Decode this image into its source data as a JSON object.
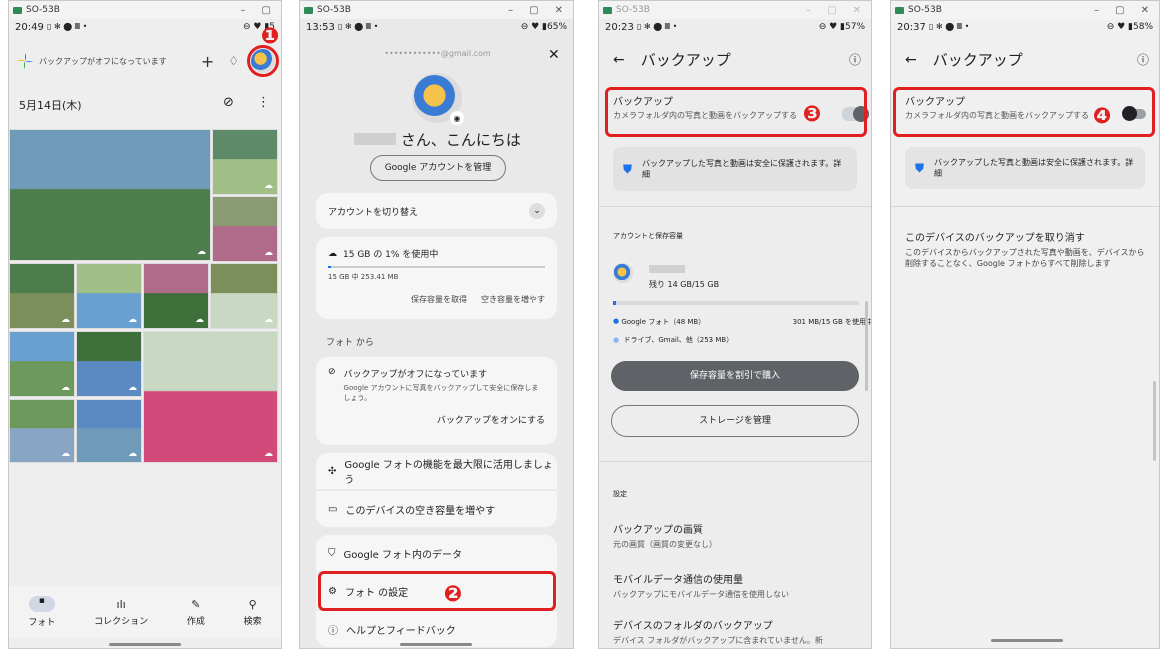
{
  "device": "SO-53B",
  "panel1": {
    "time": "20:49",
    "status_icons": "▯ ✻ ⬤ 𝄜 •",
    "battery": "⊖ ♥ ▮5",
    "banner": "バックアップがオフになっています",
    "date": "5月14日(木)",
    "nav": [
      "フォト",
      "コレクション",
      "作成",
      "検索"
    ],
    "callout": "❶",
    "photo_colors": [
      "#6f9bb9",
      "#5e8a6a",
      "#8a9a73",
      "#4e7d4d",
      "#9fbf86",
      "#b06a8a",
      "#7c8f5a",
      "#6aa0d0",
      "#3f6f3a",
      "#c9d8c2",
      "#6d9a5c",
      "#5b8ac2",
      "#d24a7a",
      "#89a5c4"
    ]
  },
  "panel2": {
    "time": "13:53",
    "status_icons": "▯ ✻ ⬤ 𝄜 •",
    "battery": "⊖ ♥ ▮65%",
    "email": "••••••••••••@gmail.com",
    "greeting": "さん、こんにちは",
    "manage_account": "Google アカウントを管理",
    "switch_account": "アカウントを切り替え",
    "storage_title": "15 GB の 1% を使用中",
    "storage_detail": "15 GB 中 253.41 MB",
    "get_storage": "保存容量を取得",
    "free_up": "空き容量を増やす",
    "from_photos": "フォト から",
    "backup_off_title": "バックアップがオフになっています",
    "backup_off_desc": "Google アカウントに写真をバックアップして安全に保存しましょう。",
    "turn_on_backup": "バックアップをオンにする",
    "make_most": "Google フォトの機能を最大限に活用しましょう",
    "free_device": "このデバイスの空き容量を増やす",
    "your_data": "Google フォト内のデータ",
    "settings": "フォト の設定",
    "help": "ヘルプとフィードバック",
    "callout": "❷"
  },
  "panel3": {
    "time": "20:23",
    "status_icons": "▯ ✻ ⬤ 𝄜 •",
    "battery": "⊖ ♥ ▮57%",
    "title": "バックアップ",
    "backup_label": "バックアップ",
    "backup_desc": "カメラフォルダ内の写真と動画をバックアップする",
    "safe_note": "バックアップした写真と動画は安全に保護されます。詳細",
    "account_storage": "アカウントと保存容量",
    "remaining": "残り 14 GB/15 GB",
    "legend_google": "Google フォト（48 MB）",
    "legend_usage": "301 MB/15 GB を使用中",
    "legend_other": "ドライブ、Gmail、他（253 MB）",
    "buy_storage": "保存容量を割引で購入",
    "manage_storage": "ストレージを管理",
    "settings_header": "設定",
    "quality_title": "バックアップの画質",
    "quality_desc": "元の画質（画質の変更なし）",
    "mobile_title": "モバイルデータ通信の使用量",
    "mobile_desc": "バックアップにモバイルデータ通信を使用しない",
    "folders_title": "デバイスのフォルダのバックアップ",
    "folders_desc": "デバイス フォルダがバックアップに含まれていません。新",
    "callout": "❸"
  },
  "panel4": {
    "time": "20:37",
    "status_icons": "▯ ✻ ⬤ 𝄜 •",
    "battery": "⊖ ♥ ▮58%",
    "title": "バックアップ",
    "backup_label": "バックアップ",
    "backup_desc": "カメラフォルダ内の写真と動画をバックアップする",
    "safe_note": "バックアップした写真と動画は安全に保護されます。詳細",
    "undo_title": "このデバイスのバックアップを取り消す",
    "undo_desc": "このデバイスからバックアップされた写真や動画を、デバイスから削除することなく、Google フォトからすべて削除します",
    "callout": "❹"
  },
  "colors": {
    "accent": "#e02020",
    "blue": "#1a73e8",
    "dark_button": "#5f6368"
  }
}
